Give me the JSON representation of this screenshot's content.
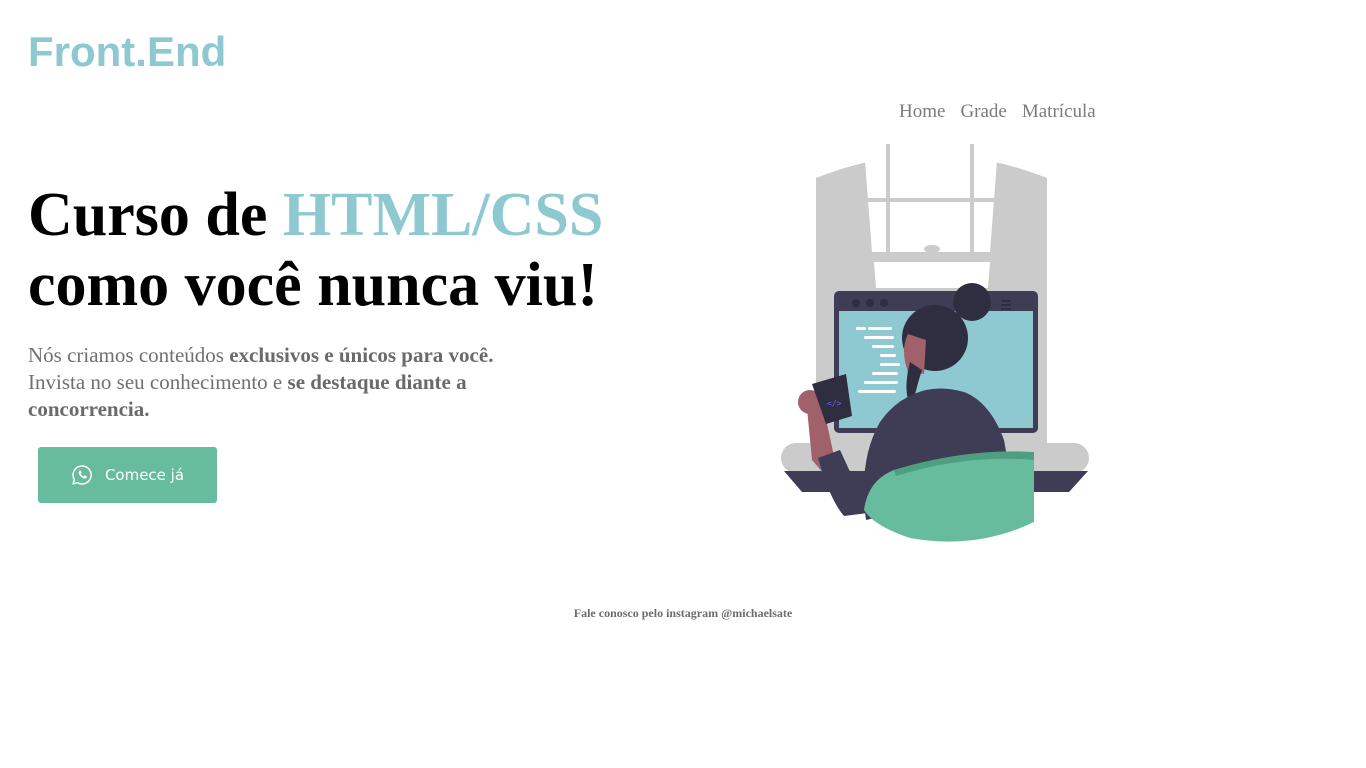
{
  "header": {
    "logo": "Front.End"
  },
  "nav": {
    "items": [
      "Home",
      "Grade",
      "Matrícula"
    ]
  },
  "hero": {
    "title_part1": "Curso de ",
    "title_accent": "HTML/CSS",
    "title_line2": "como você nunca viu!",
    "desc_1": "Nós criamos conteúdos ",
    "desc_2": "exclusivos e únicos para você.",
    "desc_3": "Invista no seu conhecimento e ",
    "desc_4": "se destaque diante a concorrencia.",
    "cta_label": "Comece já",
    "cta_icon": "whatsapp-icon"
  },
  "illustration": {
    "code_tag": "</>"
  },
  "footer": {
    "text": "Fale conosco pelo instagram @michaelsate"
  },
  "colors": {
    "accent": "#8ec8d1",
    "button": "#68bc9e",
    "text_muted": "#707070",
    "dark": "#2f2e41"
  }
}
